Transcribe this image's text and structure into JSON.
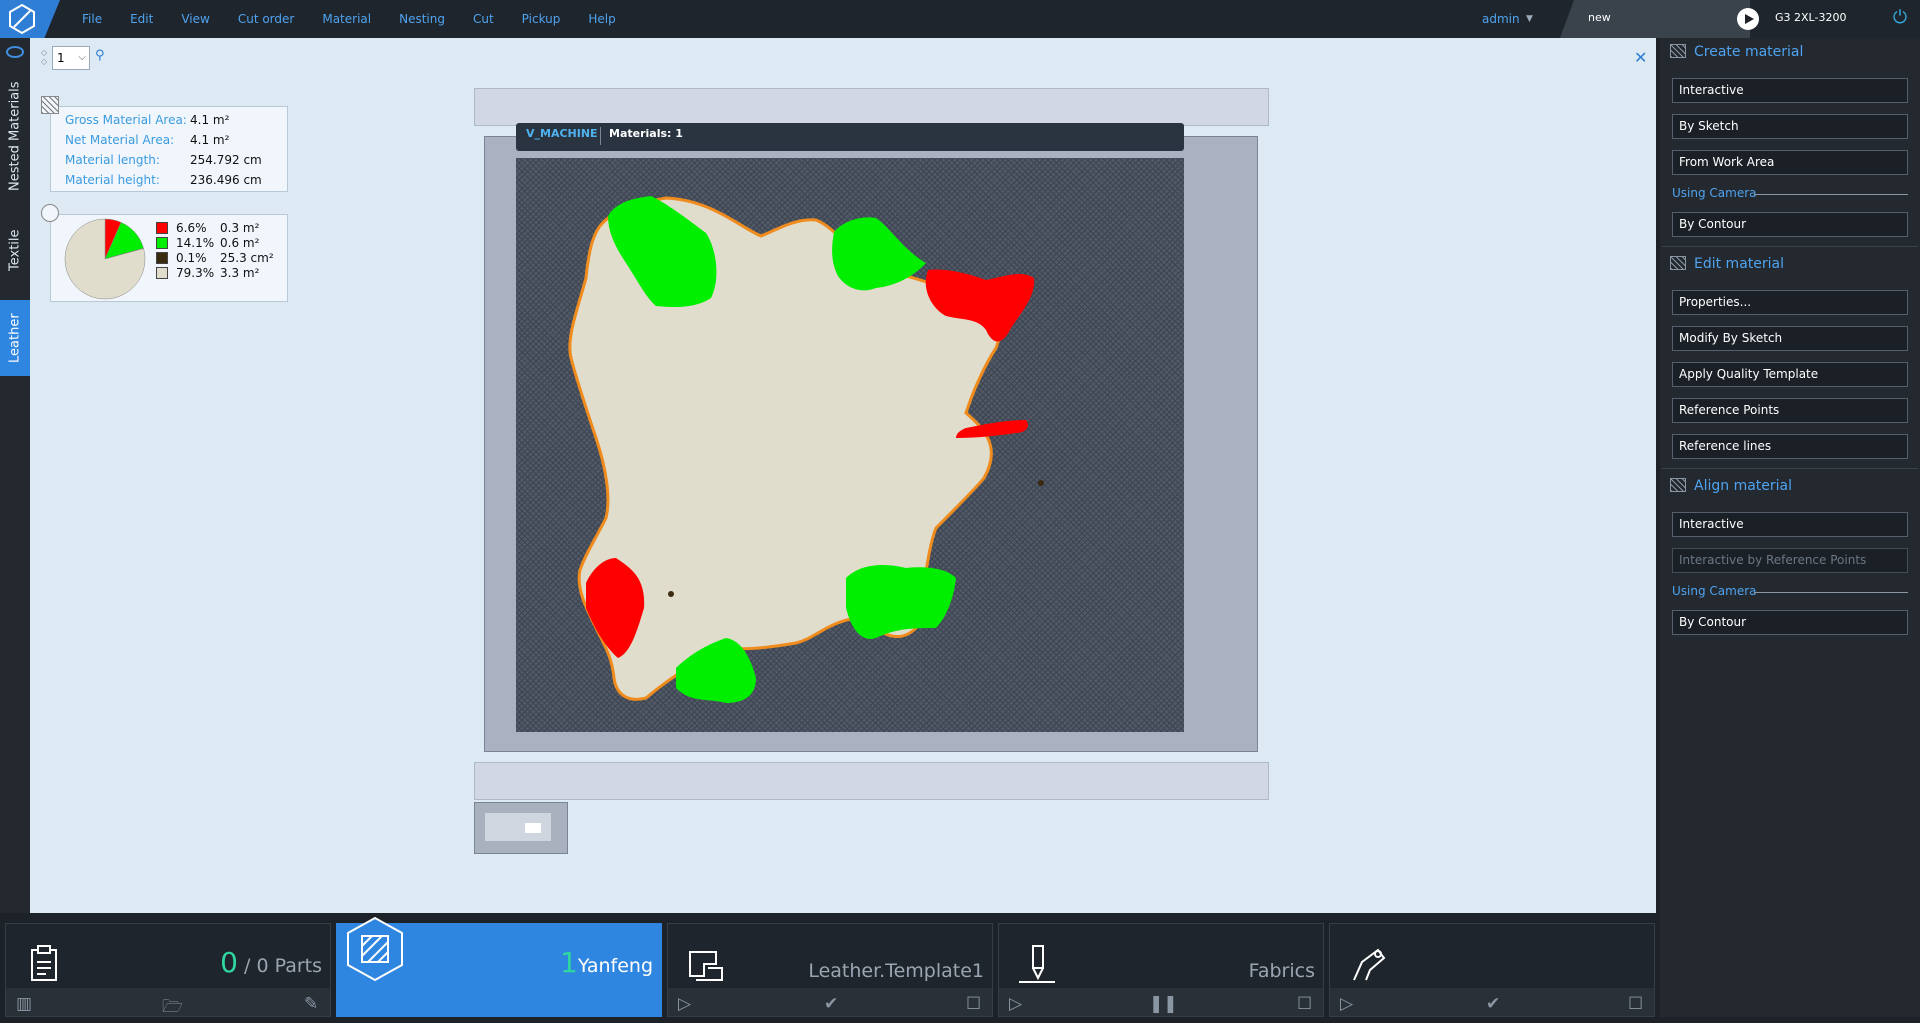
{
  "menu": [
    "File",
    "Edit",
    "View",
    "Cut order",
    "Material",
    "Nesting",
    "Cut",
    "Pickup",
    "Help"
  ],
  "user": "admin",
  "job_name": "new",
  "machine": "G3 2XL-3200",
  "left_tabs": [
    "Nested Materials",
    "Textile",
    "Leather"
  ],
  "spinner_value": "1",
  "info": {
    "rows": [
      {
        "label": "Gross Material Area:",
        "value": "4.1 m²"
      },
      {
        "label": "Net Material Area:",
        "value": "4.1 m²"
      },
      {
        "label": "Material length:",
        "value": "254.792 cm"
      },
      {
        "label": "Material height:",
        "value": "236.496 cm"
      }
    ]
  },
  "pie": {
    "legend": [
      {
        "pct": "6.6%",
        "area": "0.3 m²",
        "color": "#ff0000",
        "fraction": 0.066
      },
      {
        "pct": "14.1%",
        "area": "0.6 m²",
        "color": "#00ee00",
        "fraction": 0.141
      },
      {
        "pct": "0.1%",
        "area": "25.3 cm²",
        "color": "#3a2a10",
        "fraction": 0.001
      },
      {
        "pct": "79.3%",
        "area": "3.3 m²",
        "color": "#e0ddcc",
        "fraction": 0.793
      }
    ]
  },
  "workarea": {
    "machine_label": "V_MACHINE",
    "materials_label": "Materials: 1"
  },
  "right_panel": {
    "create": {
      "title": "Create material",
      "buttons": [
        "Interactive",
        "By Sketch",
        "From Work Area"
      ],
      "camera_label": "Using Camera",
      "camera_buttons": [
        "By Contour"
      ]
    },
    "edit": {
      "title": "Edit material",
      "buttons": [
        "Properties...",
        "Modify By Sketch",
        "Apply Quality Template",
        "Reference Points",
        "Reference lines"
      ]
    },
    "align": {
      "title": "Align material",
      "buttons": [
        "Interactive",
        "Interactive by Reference Points"
      ],
      "camera_label": "Using Camera",
      "camera_buttons": [
        "By Contour"
      ]
    }
  },
  "bottom": {
    "parts_count": "0",
    "parts_total": "/ 0 Parts",
    "material_count": "1",
    "material_name": "Yanfeng",
    "template_name": "Leather.Template1",
    "fabrics_name": "Fabrics"
  },
  "colors": {
    "accent": "#2f86e0",
    "defect_red": "#ff0000",
    "zone_green": "#00ee00",
    "leather": "#e0ddcc",
    "outline": "#f08c1e"
  }
}
